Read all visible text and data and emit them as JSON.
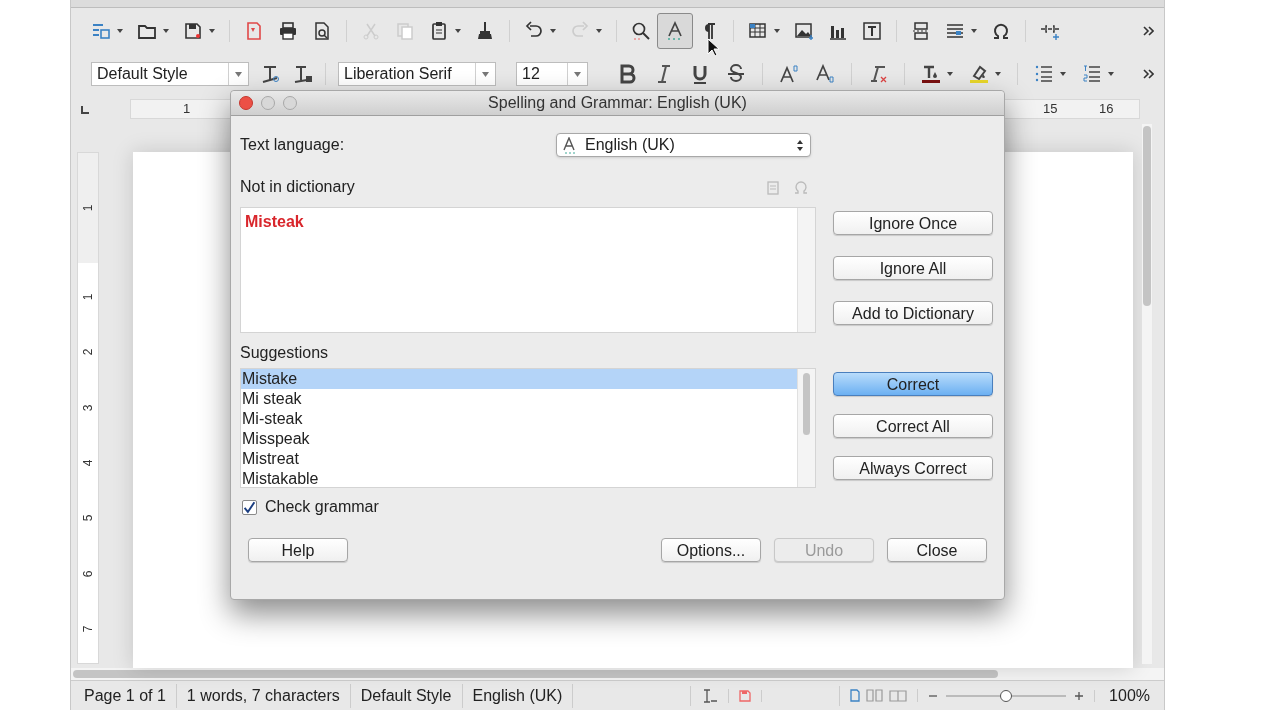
{
  "toolbar": {
    "auto_spellcheck_on": true
  },
  "formatting": {
    "paragraph_style": "Default Style",
    "font_name": "Liberation Serif",
    "font_size": "12"
  },
  "ruler": {
    "horizontal": [
      "1",
      "15",
      "16"
    ],
    "vertical": [
      "1",
      "1",
      "2",
      "3",
      "4",
      "5",
      "6",
      "7"
    ]
  },
  "dialog": {
    "title": "Spelling and Grammar: English (UK)",
    "text_language_label": "Text language:",
    "text_language": "English (UK)",
    "not_in_dictionary_label": "Not in dictionary",
    "not_in_dictionary_text": "Misteak",
    "side_buttons": [
      {
        "label": "Ignore Once",
        "default": false
      },
      {
        "label": "Ignore All",
        "default": false
      },
      {
        "label": "Add to Dictionary",
        "default": false
      }
    ],
    "suggestions_label": "Suggestions",
    "suggestions": [
      {
        "text": "Mistake",
        "selected": true
      },
      {
        "text": "Mi steak",
        "selected": false
      },
      {
        "text": "Mi-steak",
        "selected": false
      },
      {
        "text": "Misspeak",
        "selected": false
      },
      {
        "text": "Mistreat",
        "selected": false
      },
      {
        "text": "Mistakable",
        "selected": false
      }
    ],
    "correct_buttons": [
      {
        "label": "Correct",
        "default": true
      },
      {
        "label": "Correct All",
        "default": false
      },
      {
        "label": "Always Correct",
        "default": false
      }
    ],
    "check_grammar": {
      "label": "Check grammar",
      "checked": true
    },
    "bottom_buttons": [
      {
        "label": "Help",
        "disabled": false
      },
      {
        "label": "Options...",
        "disabled": false
      },
      {
        "label": "Undo",
        "disabled": true
      },
      {
        "label": "Close",
        "disabled": false
      }
    ]
  },
  "status_bar": {
    "page": "Page 1 of 1",
    "count": "1 words, 7 characters",
    "style": "Default Style",
    "language": "English (UK)",
    "zoom_slider": {
      "level": 0.5
    },
    "zoom": "100%"
  }
}
